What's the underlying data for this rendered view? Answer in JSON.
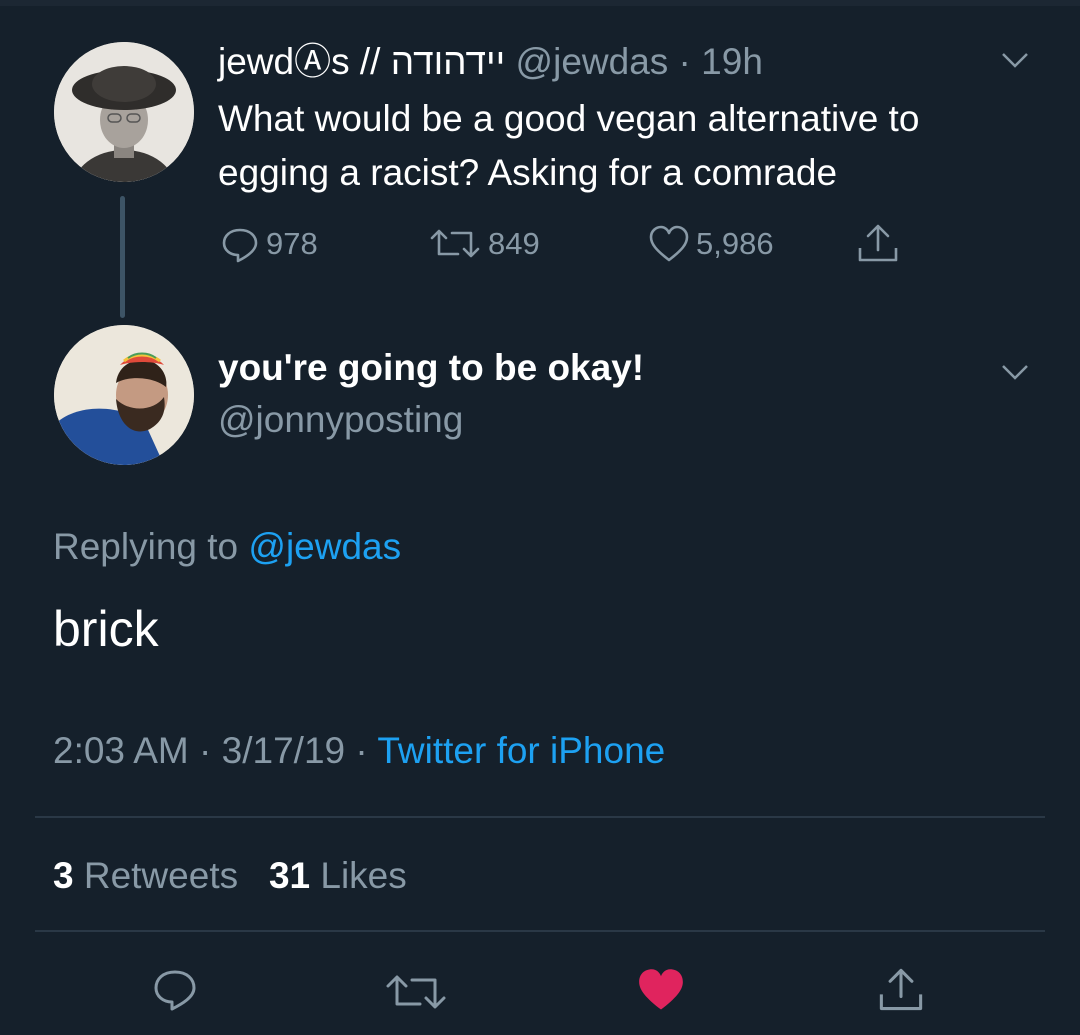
{
  "tweet1": {
    "display_name": "jewdⒶs // יידהודה",
    "handle": "@jewdas",
    "time": "19h",
    "text_line1": "What would be a good vegan alternative to",
    "text_line2": "egging a racist? Asking for a comrade",
    "replies": "978",
    "retweets": "849",
    "likes": "5,986"
  },
  "tweet2": {
    "display_name": "you're going to be okay!",
    "handle": "@jonnyposting",
    "replying_prefix": "Replying to",
    "replying_to": "@jewdas",
    "text": "brick",
    "time": "2:03 AM",
    "date": "3/17/19",
    "source": "Twitter for iPhone",
    "retweet_count": "3",
    "retweet_label": "Retweets",
    "like_count": "31",
    "like_label": "Likes"
  },
  "colors": {
    "background": "#15202b",
    "muted": "#8899a6",
    "link": "#1da1f2",
    "like_active": "#e0245e"
  },
  "icons": [
    "reply-icon",
    "retweet-icon",
    "like-icon",
    "share-icon",
    "chevron-down-icon"
  ],
  "action_bar": {
    "liked": true
  }
}
